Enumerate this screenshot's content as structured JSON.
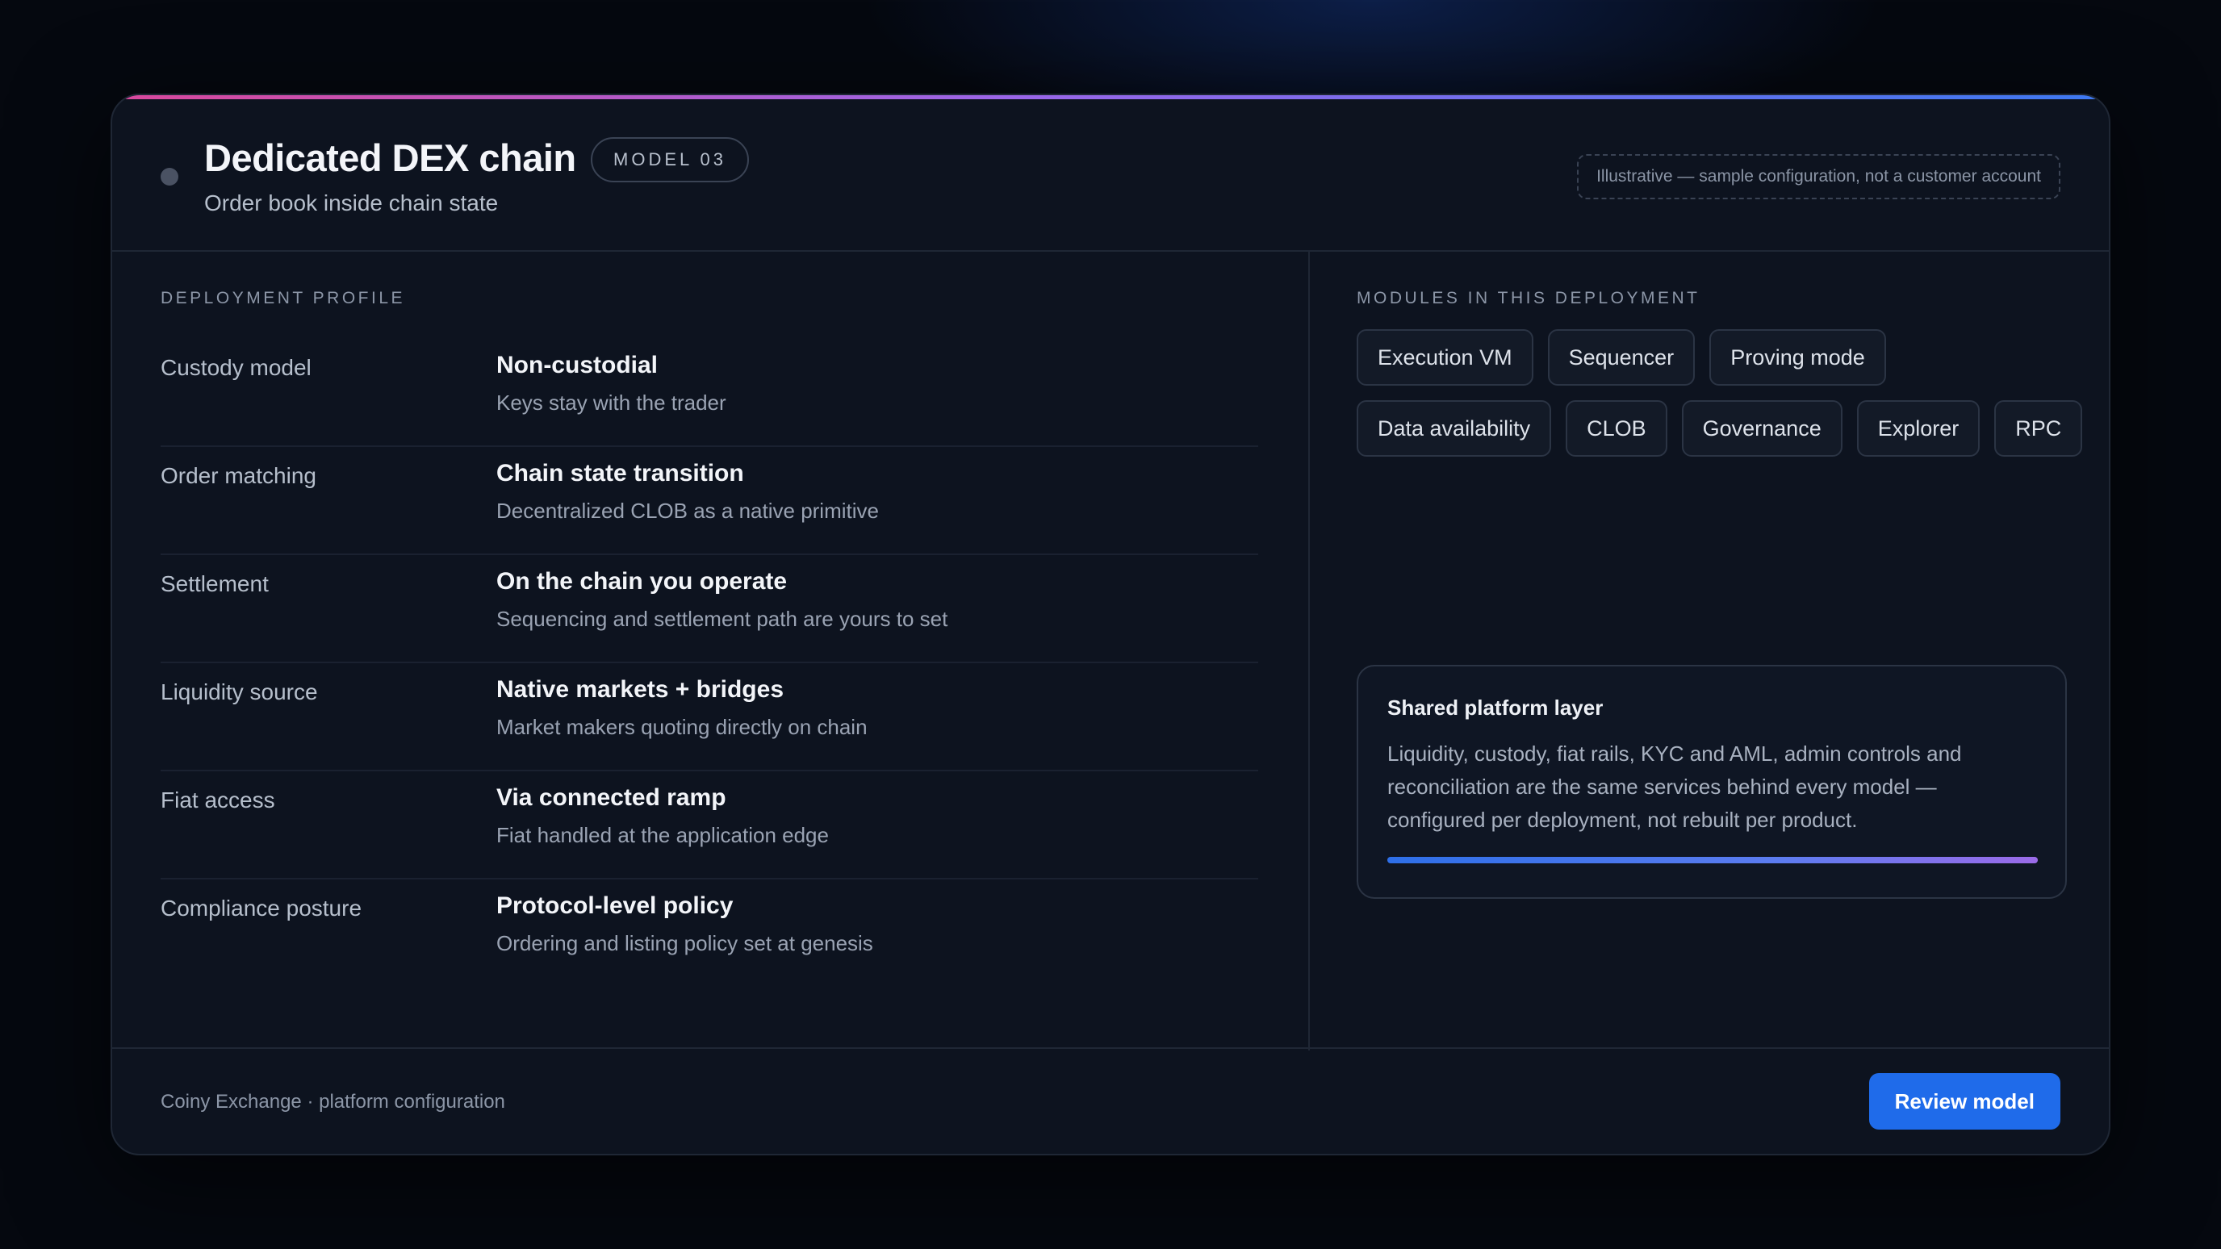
{
  "header": {
    "title": "Dedicated DEX chain",
    "badge": "MODEL 03",
    "subtitle": "Order book inside chain state",
    "notice": "Illustrative — sample configuration, not a customer account"
  },
  "profile": {
    "section_label": "DEPLOYMENT PROFILE",
    "rows": [
      {
        "key": "Custody model",
        "title": "Non-custodial",
        "desc": "Keys stay with the trader"
      },
      {
        "key": "Order matching",
        "title": "Chain state transition",
        "desc": "Decentralized CLOB as a native primitive"
      },
      {
        "key": "Settlement",
        "title": "On the chain you operate",
        "desc": "Sequencing and settlement path are yours to set"
      },
      {
        "key": "Liquidity source",
        "title": "Native markets + bridges",
        "desc": "Market makers quoting directly on chain"
      },
      {
        "key": "Fiat access",
        "title": "Via connected ramp",
        "desc": "Fiat handled at the application edge"
      },
      {
        "key": "Compliance posture",
        "title": "Protocol-level policy",
        "desc": "Ordering and listing policy set at genesis"
      }
    ]
  },
  "modules": {
    "section_label": "MODULES IN THIS DEPLOYMENT",
    "chips": [
      "Execution VM",
      "Sequencer",
      "Proving mode",
      "Data availability",
      "CLOB",
      "Governance",
      "Explorer",
      "RPC"
    ]
  },
  "shared": {
    "title": "Shared platform layer",
    "text": "Liquidity, custody, fiat rails, KYC and AML, admin controls and reconciliation are the same services behind every model — configured per deployment, not rebuilt per product.",
    "progress": 1.0
  },
  "footer": {
    "text": "Coiny Exchange · platform configuration",
    "button_label": "Review model"
  },
  "colors": {
    "accent_blue": "#1f6bea",
    "accent_pink": "#d9489c",
    "accent_purple": "#9a66e8"
  }
}
